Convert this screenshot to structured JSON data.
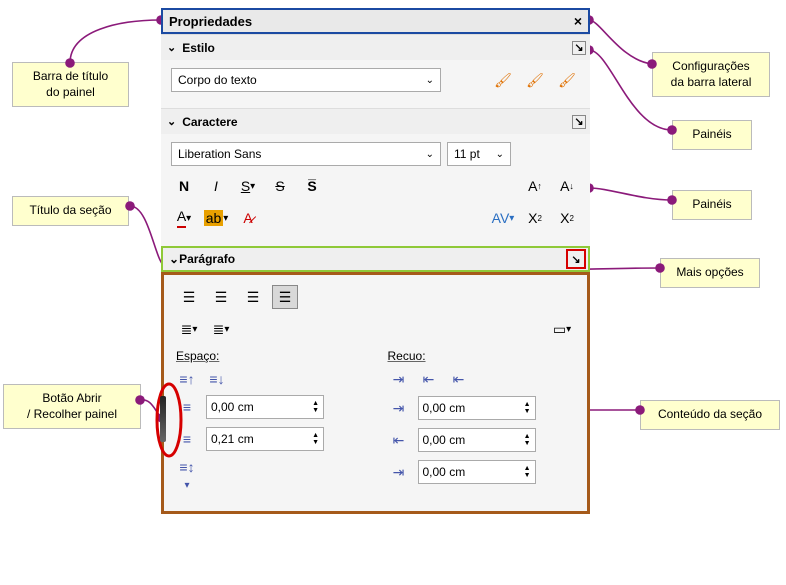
{
  "panel": {
    "title": "Propriedades"
  },
  "sections": {
    "estilo": {
      "title": "Estilo",
      "style_name": "Corpo do texto"
    },
    "caractere": {
      "title": "Caractere",
      "font": "Liberation Sans",
      "size": "11 pt"
    },
    "paragrafo": {
      "title": "Parágrafo",
      "spacing_label": "Espaço:",
      "indent_label": "Recuo:",
      "above": "0,00 cm",
      "below": "0,21 cm",
      "left": "0,00 cm",
      "right": "0,00 cm",
      "firstline": "0,00 cm"
    }
  },
  "callouts": {
    "title_bar": "Barra de título\ndo painel",
    "section_title": "Título da seção",
    "toggle_btn": "Botão Abrir\n/ Recolher painel",
    "sidebar_cfg": "Configurações\nda barra lateral",
    "panels1": "Painéis",
    "panels2": "Painéis",
    "more": "Mais opções",
    "content": "Conteúdo da seção"
  }
}
